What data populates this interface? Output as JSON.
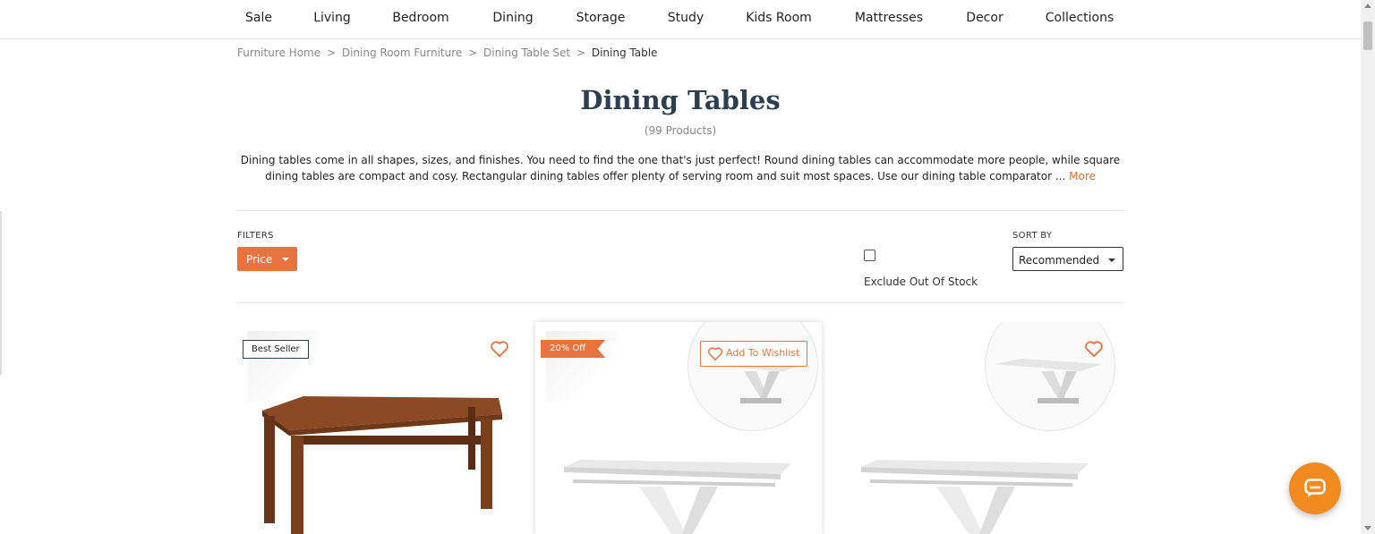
{
  "nav": {
    "items": [
      "Sale",
      "Living",
      "Bedroom",
      "Dining",
      "Storage",
      "Study",
      "Kids Room",
      "Mattresses",
      "Decor",
      "Collections"
    ]
  },
  "breadcrumb": {
    "items": [
      "Furniture Home",
      "Dining Room Furniture",
      "Dining Table Set"
    ],
    "separator": ">",
    "current": "Dining Table"
  },
  "header": {
    "title": "Dining Tables",
    "count": "(99 Products)",
    "description": "Dining tables come in all shapes, sizes, and finishes. You need to find the one that's just perfect! Round dining tables can accommodate more people, while square dining tables are compact and cosy. Rectangular dining tables offer plenty of serving room and suit most spaces. Use our dining table comparator ...",
    "more_label": "More"
  },
  "filters": {
    "label": "FILTERS",
    "price_label": "Price",
    "exclude_label": "Exclude Out Of Stock",
    "exclude_checked": false
  },
  "sort": {
    "label": "SORT BY",
    "selected": "Recommended"
  },
  "products": [
    {
      "badge": "Best Seller",
      "image": "wooden-rectangular-dining-table"
    },
    {
      "badge": "20% Off",
      "wishlist_label": "Add To Wishlist",
      "image": "white-extendable-v-leg-table"
    },
    {
      "badge": "",
      "image": "white-extendable-v-leg-table"
    }
  ],
  "colors": {
    "accent": "#e8733f",
    "title": "#2c3e50",
    "chat": "#f18a1f"
  }
}
